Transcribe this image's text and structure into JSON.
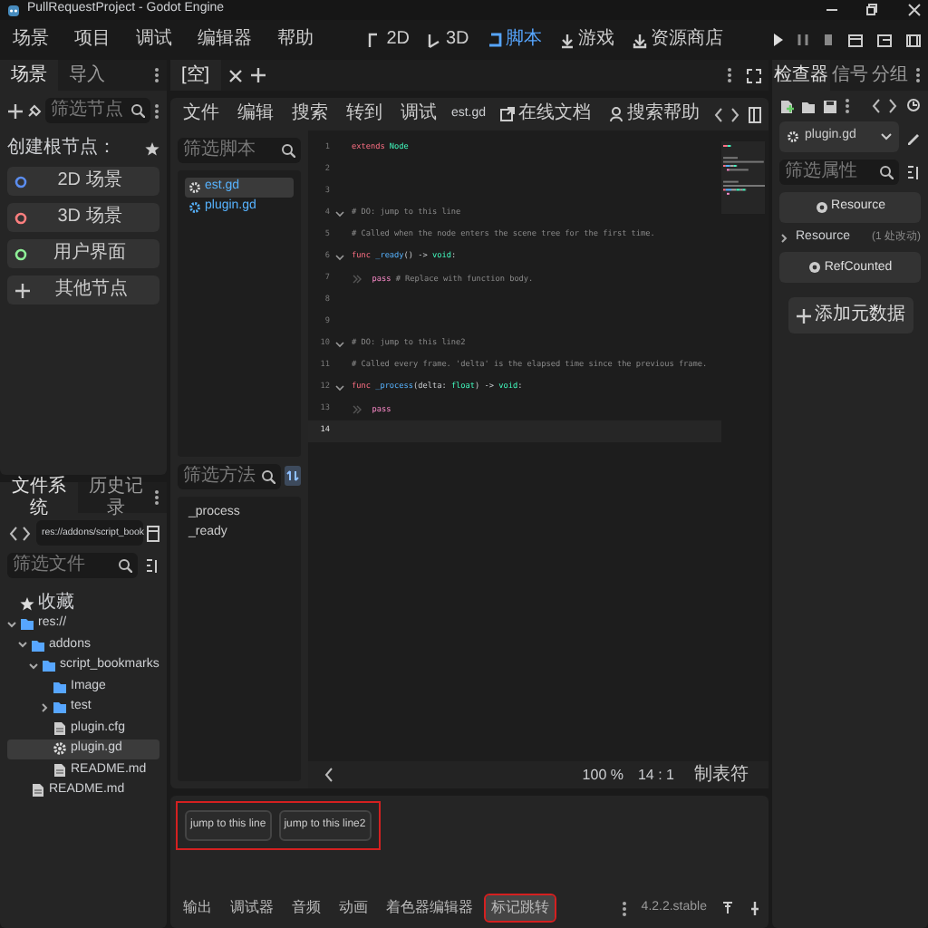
{
  "window": {
    "title": "PullRequestProject - Godot Engine"
  },
  "menu": [
    "场景",
    "项目",
    "调试",
    "编辑器",
    "帮助"
  ],
  "workspaces": [
    {
      "label": "2D",
      "kind": "planar",
      "selected": false
    },
    {
      "label": "3D",
      "kind": "spatial",
      "selected": false
    },
    {
      "label": "脚本",
      "kind": "script",
      "selected": true
    },
    {
      "label": "游戏",
      "kind": "game",
      "selected": false
    },
    {
      "label": "资源商店",
      "kind": "assetlib",
      "selected": false
    }
  ],
  "scene_dock": {
    "tabs": [
      {
        "label": "场景",
        "selected": true
      },
      {
        "label": "导入",
        "selected": false
      }
    ],
    "filter_placeholder": "筛选节点",
    "create_root_label": "创建根节点：",
    "root_options": [
      {
        "label": "2D 场景",
        "kind": "node",
        "color": "#5b8def"
      },
      {
        "label": "3D 场景",
        "kind": "node",
        "color": "#fc7f7f"
      },
      {
        "label": "用户界面",
        "kind": "node",
        "color": "#8eef97"
      },
      {
        "label": "其他节点",
        "kind": "add"
      }
    ]
  },
  "filesystem": {
    "tabs": [
      {
        "label": "文件系统",
        "selected": true
      },
      {
        "label": "历史记录",
        "selected": false
      }
    ],
    "path": "res://addons/script_book",
    "filter_placeholder": "筛选文件",
    "tree": [
      {
        "label": "收藏",
        "kind": "favorites",
        "selected": false
      },
      {
        "label": "res://",
        "kind": "folder",
        "expanded": true,
        "selected": false,
        "children": [
          {
            "label": "addons",
            "kind": "folder",
            "expanded": true,
            "selected": false,
            "children": [
              {
                "label": "script_bookmarks",
                "kind": "folder",
                "expanded": true,
                "selected": false,
                "children": [
                  {
                    "label": "Image",
                    "kind": "folder",
                    "selected": false
                  },
                  {
                    "label": "test",
                    "kind": "folder",
                    "expanded": false,
                    "selected": false
                  },
                  {
                    "label": "plugin.cfg",
                    "kind": "file",
                    "selected": false
                  },
                  {
                    "label": "plugin.gd",
                    "kind": "script",
                    "selected": true
                  },
                  {
                    "label": "README.md",
                    "kind": "file",
                    "selected": false
                  }
                ]
              }
            ]
          },
          {
            "label": "README.md",
            "kind": "file",
            "selected": false
          }
        ]
      }
    ]
  },
  "script_editor": {
    "doc_tabs": [
      {
        "label": "[空]",
        "selected": true
      }
    ],
    "menu": [
      "文件",
      "编辑",
      "搜索",
      "转到",
      "调试"
    ],
    "file_name": "est.gd",
    "links": [
      "在线文档",
      "搜索帮助"
    ],
    "script_filter_placeholder": "筛选脚本",
    "scripts": [
      {
        "label": "est.gd",
        "selected": true
      },
      {
        "label": "plugin.gd",
        "selected": false
      }
    ],
    "method_filter_placeholder": "筛选方法",
    "methods": [
      "_process",
      "_ready"
    ],
    "lines": [
      {
        "number": "1",
        "fold": false,
        "current": false,
        "tokens": [
          {
            "text": "extends",
            "kind": "keyword"
          },
          {
            "text": " Node",
            "kind": "type"
          }
        ]
      },
      {
        "number": "2",
        "fold": false,
        "current": false
      },
      {
        "number": "3",
        "fold": false,
        "current": false
      },
      {
        "number": "4",
        "fold": true,
        "current": false,
        "tokens": [
          {
            "text": "# DO: jump to this line",
            "kind": "comment"
          }
        ]
      },
      {
        "number": "5",
        "fold": false,
        "current": false,
        "tokens": [
          {
            "text": "# Called when the node enters the scene tree for the first time.",
            "kind": "comment"
          }
        ]
      },
      {
        "number": "6",
        "fold": true,
        "current": false,
        "tokens": [
          {
            "text": "func",
            "kind": "keyword"
          },
          {
            "text": " _ready",
            "kind": "function"
          },
          {
            "text": "() -> "
          },
          {
            "text": "void",
            "kind": "type"
          },
          {
            "text": ":"
          }
        ]
      },
      {
        "number": "7",
        "fold": false,
        "current": false,
        "tokens": [
          {
            "kind": "tab"
          },
          {
            "text": "pass",
            "kind": "control"
          },
          {
            "text": " # Replace with function body.",
            "kind": "comment"
          }
        ]
      },
      {
        "number": "8",
        "fold": false,
        "current": false
      },
      {
        "number": "9",
        "fold": false,
        "current": false
      },
      {
        "number": "10",
        "fold": true,
        "current": false,
        "tokens": [
          {
            "text": "# DO: jump to this line2",
            "kind": "comment"
          }
        ]
      },
      {
        "number": "11",
        "fold": false,
        "current": false,
        "tokens": [
          {
            "text": "# Called every frame. 'delta' is the elapsed time since the previous frame.",
            "kind": "comment"
          }
        ]
      },
      {
        "number": "12",
        "fold": true,
        "current": false,
        "tokens": [
          {
            "text": "func",
            "kind": "keyword"
          },
          {
            "text": " _process",
            "kind": "function"
          },
          {
            "text": "(delta: "
          },
          {
            "text": "float",
            "kind": "type"
          },
          {
            "text": ") -> "
          },
          {
            "text": "void",
            "kind": "type"
          },
          {
            "text": ":"
          }
        ]
      },
      {
        "number": "13",
        "fold": false,
        "current": false,
        "tokens": [
          {
            "kind": "tab"
          },
          {
            "text": "pass",
            "kind": "control"
          }
        ]
      },
      {
        "number": "14",
        "fold": false,
        "current": true
      }
    ],
    "status": {
      "zoom": "100 %",
      "position": "14 :  1",
      "indent_mode": "制表符"
    }
  },
  "bottom_panel": {
    "highlighted": true,
    "bookmarks": [
      "jump to this line",
      "jump to this line2"
    ],
    "tabs": [
      {
        "label": "输出",
        "selected": false,
        "highlighted": false
      },
      {
        "label": "调试器",
        "selected": false,
        "highlighted": false
      },
      {
        "label": "音频",
        "selected": false,
        "highlighted": false
      },
      {
        "label": "动画",
        "selected": false,
        "highlighted": false
      },
      {
        "label": "着色器编辑器",
        "selected": false,
        "highlighted": false
      },
      {
        "label": "标记跳转",
        "selected": true,
        "highlighted": true
      }
    ],
    "version": "4.2.2.stable"
  },
  "inspector": {
    "tabs": [
      {
        "label": "检查器",
        "selected": true
      },
      {
        "label": "信号",
        "selected": false
      },
      {
        "label": "分组",
        "selected": false
      }
    ],
    "object": "plugin.gd",
    "filter_placeholder": "筛选属性",
    "class_header": "Resource",
    "section": {
      "label": "Resource",
      "note": "(1 处改动)",
      "expanded": false
    },
    "subclass_header": "RefCounted",
    "add_metadata": "添加元数据"
  }
}
